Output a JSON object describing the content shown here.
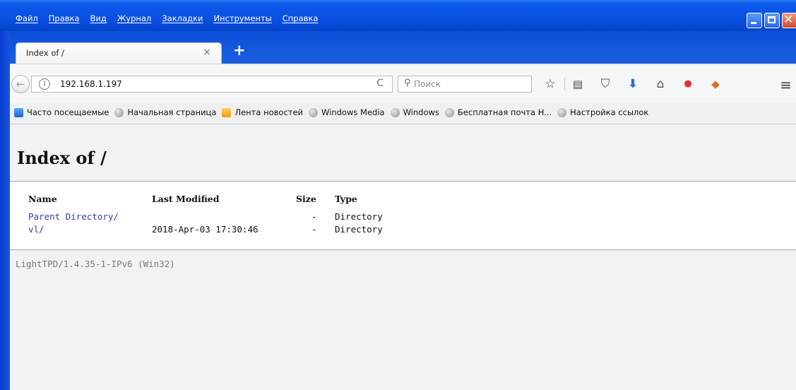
{
  "menu": [
    "Файл",
    "Правка",
    "Вид",
    "Журнал",
    "Закладки",
    "Инструменты",
    "Справка"
  ],
  "tab": {
    "title": "Index of /",
    "close": "×",
    "new_tab": "+"
  },
  "nav": {
    "url": "192.168.1.197",
    "search_placeholder": "Поиск",
    "back": "←",
    "info": "i",
    "reload": "C"
  },
  "bookmarks": [
    {
      "label": "Часто посещаемые",
      "icon": "search-folder-icon"
    },
    {
      "label": "Начальная страница",
      "icon": "globe-icon"
    },
    {
      "label": "Лента новостей",
      "icon": "rss-icon"
    },
    {
      "label": "Windows Media",
      "icon": "globe-icon"
    },
    {
      "label": "Windows",
      "icon": "globe-icon"
    },
    {
      "label": "Бесплатная почта H...",
      "icon": "globe-icon"
    },
    {
      "label": "Настройка ссылок",
      "icon": "globe-icon"
    }
  ],
  "page": {
    "title": "Index of /",
    "headers": {
      "name": "Name",
      "modified": "Last Modified",
      "size": "Size",
      "type": "Type"
    },
    "rows": [
      {
        "name": "Parent Directory/",
        "modified": "",
        "size": "-",
        "type": "Directory"
      },
      {
        "name": "vl/",
        "modified": "2018-Apr-03 17:30:46",
        "size": "-",
        "type": "Directory"
      }
    ],
    "footer": "LightTPD/1.4.35-1-IPv6 (Win32)"
  },
  "colors": {
    "xp_blue": "#0a50e4",
    "link": "#3a3ab2",
    "close_red": "#d8452a"
  }
}
